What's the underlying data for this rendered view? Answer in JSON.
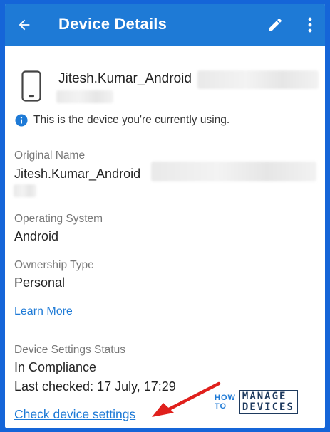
{
  "appbar": {
    "title": "Device Details",
    "back_icon": "arrow-left-icon",
    "edit_icon": "pencil-icon",
    "more_icon": "more-vertical-icon",
    "background": "#1e7ad6"
  },
  "device": {
    "name": "Jitesh.Kumar_Android",
    "icon": "smartphone-icon"
  },
  "info": {
    "icon": "info-icon",
    "text": "This is the device you're currently using."
  },
  "original_name": {
    "label": "Original Name",
    "value": "Jitesh.Kumar_Android"
  },
  "operating_system": {
    "label": "Operating System",
    "value": "Android"
  },
  "ownership": {
    "label": "Ownership Type",
    "value": "Personal"
  },
  "learn_more": "Learn More",
  "settings_status": {
    "label": "Device Settings Status",
    "value": "In Compliance",
    "last_checked": "Last checked: 17 July, 17:29"
  },
  "check_settings_link": "Check device settings",
  "watermark": {
    "howto": [
      "HOW",
      "TO"
    ],
    "manage": "MANAGE",
    "devices": "DEVICES"
  },
  "colors": {
    "accent": "#1e7ad6",
    "border": "#1565d8",
    "annotation_arrow": "#e0201c"
  }
}
